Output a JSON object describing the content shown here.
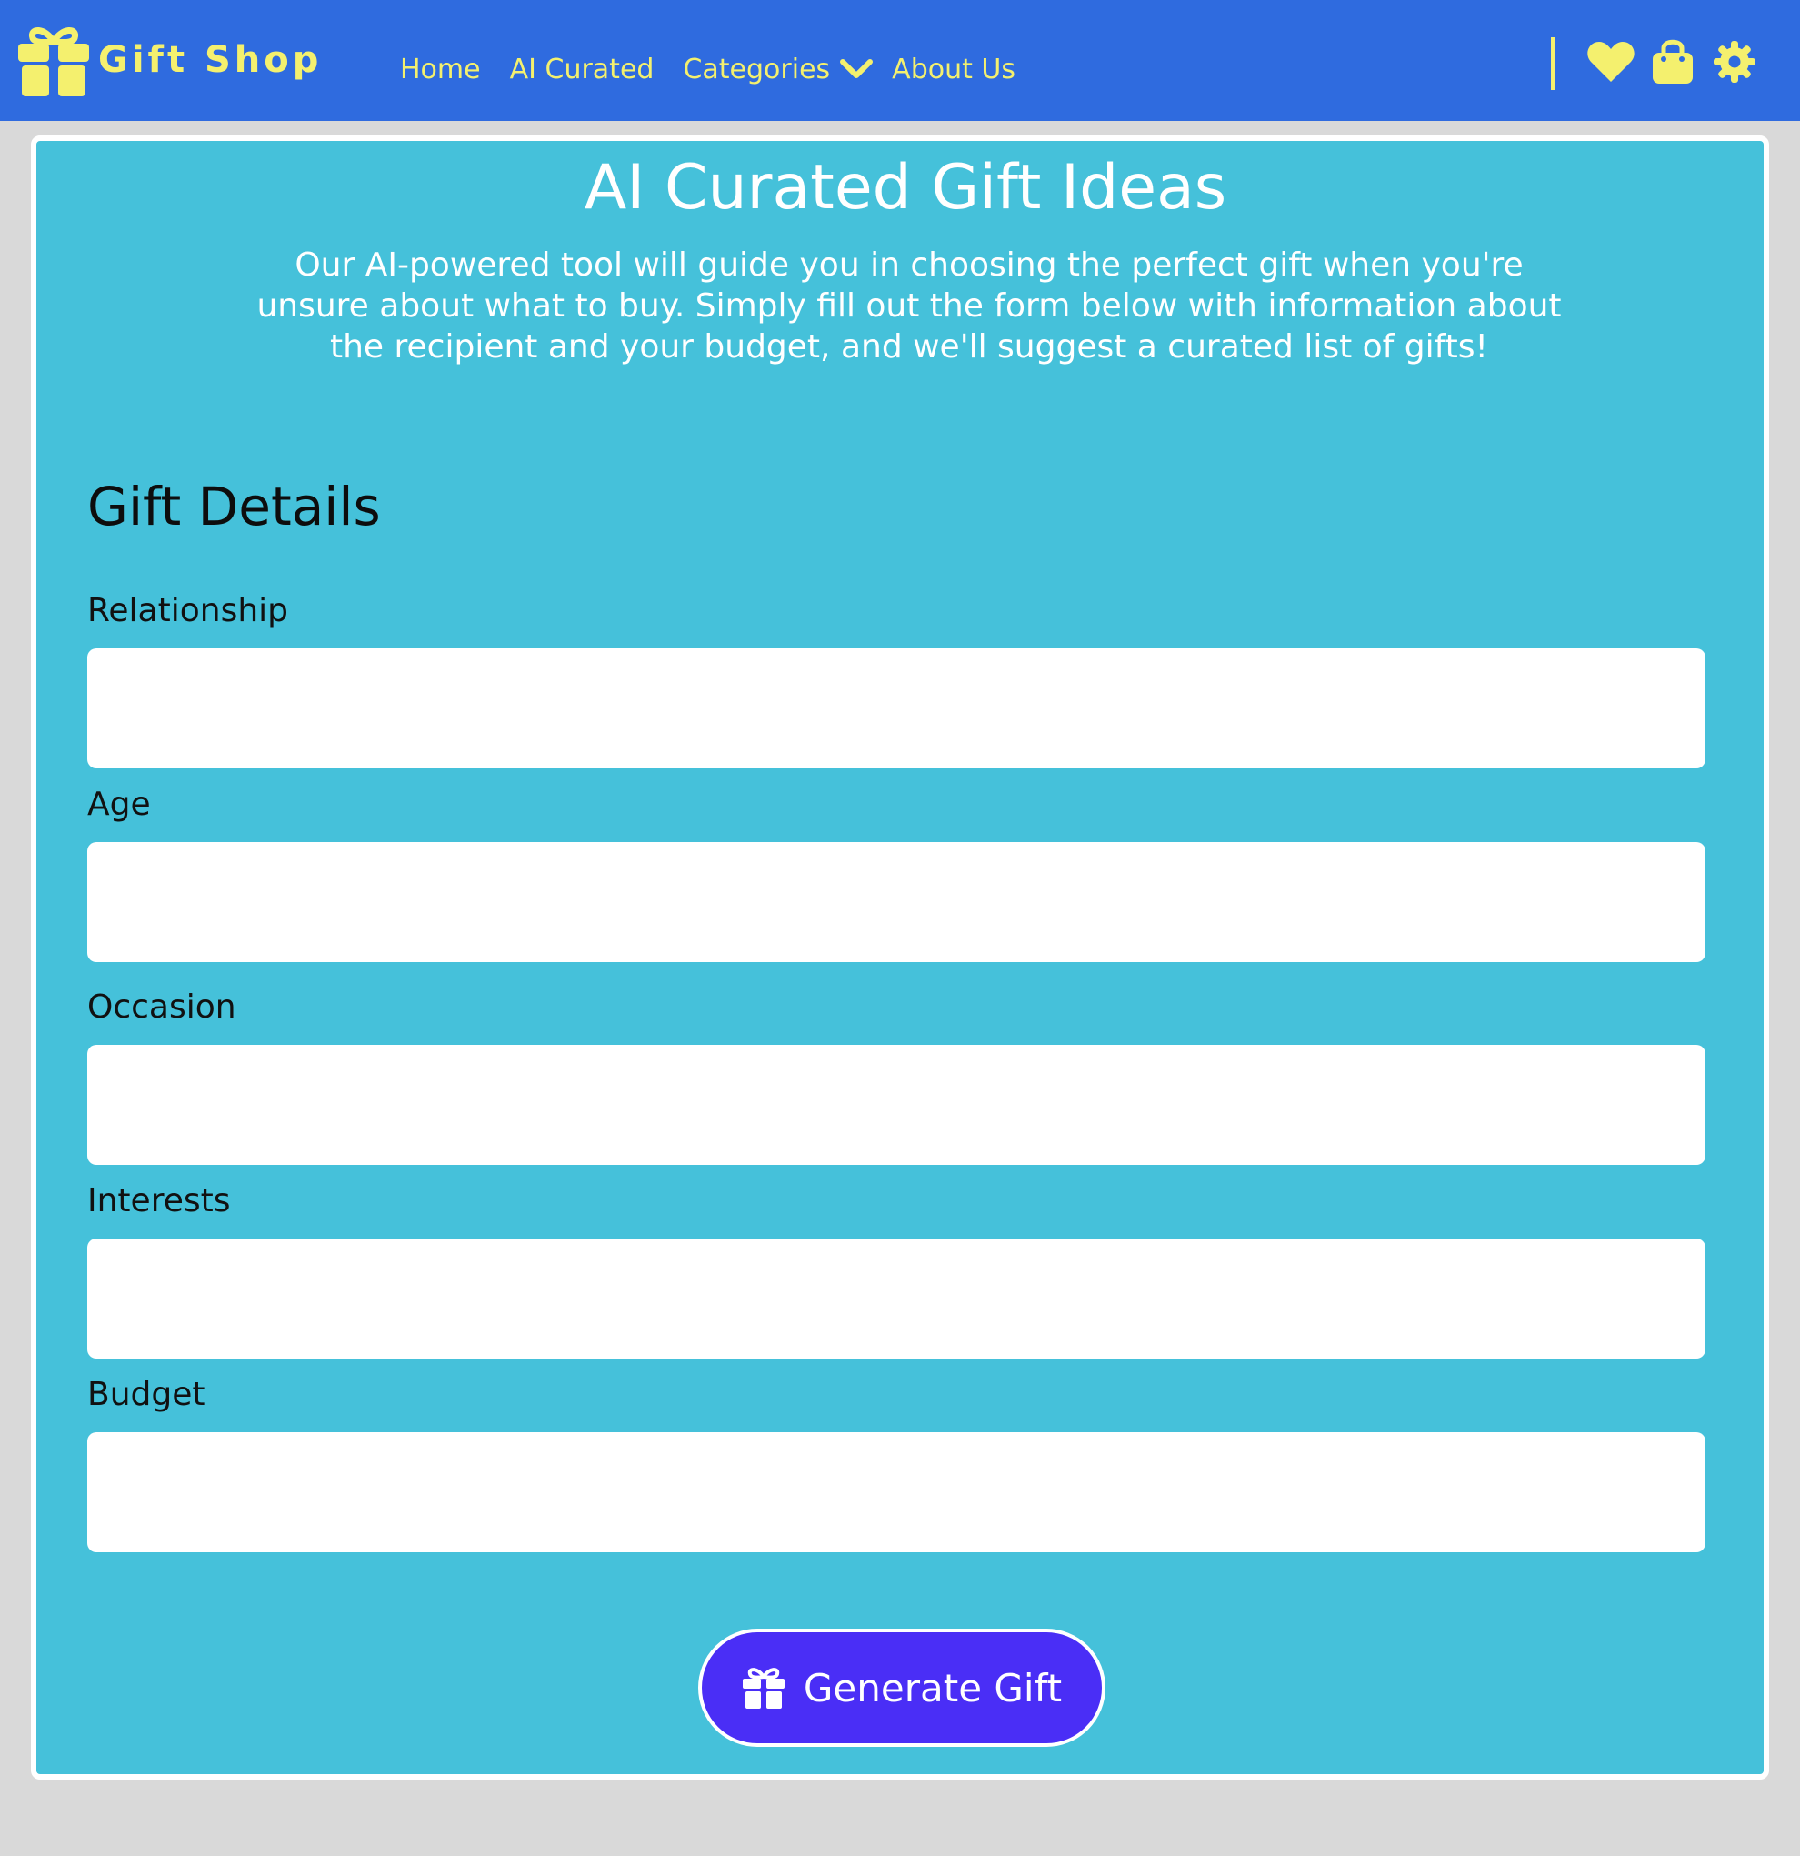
{
  "colors": {
    "navbar_bg": "#2f6bdf",
    "accent_yellow": "#f4f06e",
    "card_bg": "#45c1da",
    "button_bg": "#4a2ef6",
    "page_bg": "#d9d9d9"
  },
  "brand": {
    "name": "Gift Shop",
    "icon": "gift-icon"
  },
  "nav": {
    "links": [
      "Home",
      "AI Curated",
      "Categories",
      "About Us"
    ],
    "dropdown_icon": "chevron-down-icon",
    "right_icons": [
      "heart-icon",
      "shopping-bag-icon",
      "gear-icon"
    ]
  },
  "main": {
    "title": "AI Curated Gift Ideas",
    "intro": "Our AI-powered tool will guide you in choosing the perfect gift when you're unsure about what to buy. Simply fill out the form below with information about the recipient and your budget, and we'll suggest a curated list of gifts!",
    "form": {
      "title": "Gift Details",
      "fields": [
        {
          "label": "Relationship",
          "value": "",
          "placeholder": ""
        },
        {
          "label": "Age",
          "value": "",
          "placeholder": ""
        },
        {
          "label": "Occasion",
          "value": "",
          "placeholder": ""
        },
        {
          "label": "Interests",
          "value": "",
          "placeholder": ""
        },
        {
          "label": "Budget",
          "value": "",
          "placeholder": ""
        }
      ],
      "submit_label": "Generate Gift",
      "submit_icon": "gift-icon"
    }
  }
}
